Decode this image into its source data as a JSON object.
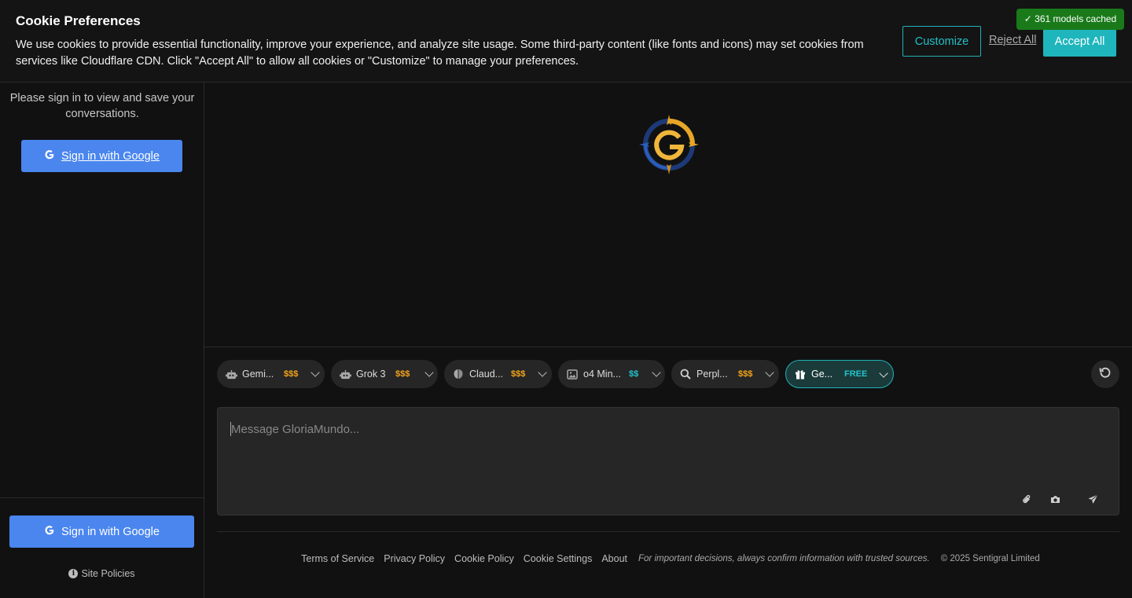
{
  "cookie": {
    "title": "Cookie Preferences",
    "text": "We use cookies to provide essential functionality, improve your experience, and analyze site usage. Some third-party content (like fonts and icons) may set cookies from services like Cloudflare CDN. Click \"Accept All\" to allow all cookies or \"Customize\" to manage your preferences.",
    "customize_label": "Customize",
    "reject_label": "Reject All",
    "accept_label": "Accept All"
  },
  "cache_badge": "✓ 361 models cached",
  "sidebar": {
    "message": "Please sign in to view and save your conversations.",
    "signin_top_label": "Sign in with Google",
    "signin_bottom_label": "Sign in with Google",
    "site_policies_label": "Site Policies"
  },
  "models": [
    {
      "name": "Gemi...",
      "price": "$$$",
      "icon": "robot-icon",
      "price_color": "#f2a31b"
    },
    {
      "name": "Grok 3",
      "price": "$$$",
      "icon": "robot-icon",
      "price_color": "#f2a31b"
    },
    {
      "name": "Claud...",
      "price": "$$$",
      "icon": "brain-icon",
      "price_color": "#f2a31b"
    },
    {
      "name": "o4 Min...",
      "price": "$$",
      "icon": "image-icon",
      "price_color": "#22c4cc"
    },
    {
      "name": "Perpl...",
      "price": "$$$",
      "icon": "search-icon",
      "price_color": "#f2a31b"
    },
    {
      "name": "Ge...",
      "price": "FREE",
      "icon": "gift-icon",
      "price_color": "#22c4cc",
      "selected": true
    }
  ],
  "composer": {
    "placeholder": "Message GloriaMundo..."
  },
  "footer": {
    "links": [
      "Terms of Service",
      "Privacy Policy",
      "Cookie Policy",
      "Cookie Settings",
      "About"
    ],
    "note": "For important decisions, always confirm information with trusted sources.",
    "copyright": "© 2025 Sentigral Limited"
  },
  "colors": {
    "accent": "#20b2b8",
    "google_button": "#4a86ee",
    "badge_green": "#1a7a1a",
    "background": "#111111"
  }
}
